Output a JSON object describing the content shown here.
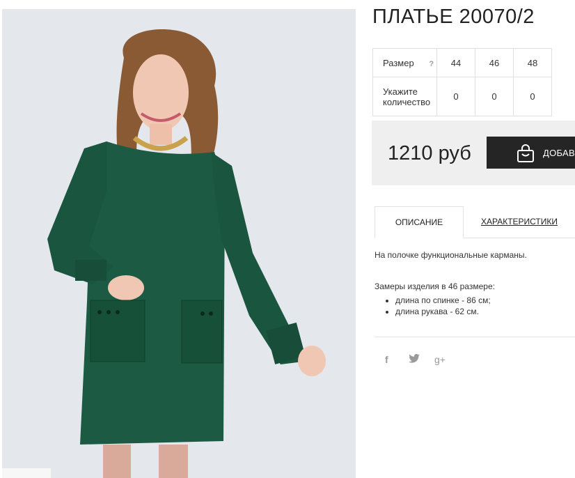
{
  "product": {
    "title": "ПЛАТЬЕ 20070/2"
  },
  "size_table": {
    "size_label": "Размер",
    "help_glyph": "?",
    "sizes": [
      "44",
      "46",
      "48"
    ],
    "qty_label_line1": "Укажите",
    "qty_label_line2": "количество",
    "quantities": [
      "0",
      "0",
      "0"
    ]
  },
  "purchase": {
    "price": "1210 руб",
    "cart_label": "ДОБАВИТЬ"
  },
  "tabs": {
    "description": "ОПИСАНИЕ",
    "characteristics": "ХАРАКТЕРИСТИКИ"
  },
  "description": {
    "line1": "На полочке функциональные карманы.",
    "line2": "Замеры изделия в 46 размере:",
    "bullets": [
      "длина по спинке - 86 см;",
      "длина рукава - 62 см."
    ]
  },
  "social": {
    "facebook": "f",
    "google": "g+"
  },
  "colors": {
    "dress": "#1c5a43",
    "photo_bg": "#e4e7ec",
    "button": "#252525"
  },
  "icons": [
    "facebook-icon",
    "twitter-icon",
    "google-plus-icon",
    "shopping-bag-icon",
    "help-icon"
  ]
}
